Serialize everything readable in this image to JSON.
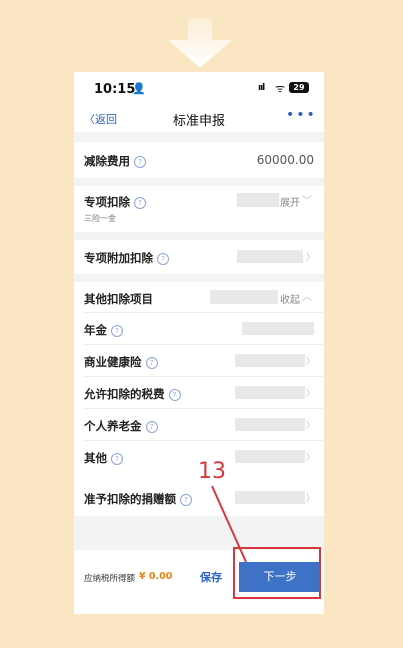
{
  "status_bar": {
    "time": "10:15",
    "person_glyph": "👤",
    "signal": "ııl",
    "wifi_glyph": "ᯤ",
    "battery": "29"
  },
  "nav": {
    "back_label": "〈返回",
    "title": "标准申报",
    "more": "•••"
  },
  "rows": {
    "deduction_fee": {
      "label": "减除费用",
      "value": "60000.00"
    },
    "special_deduction": {
      "label": "专项扣除",
      "sub": "三险一金",
      "action": "展开"
    },
    "special_additional": {
      "label": "专项附加扣除"
    },
    "other_deduction": {
      "label": "其他扣除项目",
      "action": "收起"
    },
    "annuity": {
      "label": "年金"
    },
    "health_insurance": {
      "label": "商业健康险"
    },
    "allowed_tax": {
      "label": "允许扣除的税费"
    },
    "pension": {
      "label": "个人养老金"
    },
    "other": {
      "label": "其他"
    },
    "donation": {
      "label": "准予扣除的捐赠额"
    }
  },
  "bottom": {
    "taxable_label": "应纳税所得额",
    "taxable_value": "¥ 0.00",
    "save_label": "保存",
    "next_label": "下一步"
  },
  "annotation": {
    "step_number": "13",
    "color": "#d9363e"
  },
  "colors": {
    "accent": "#3d72c6",
    "background": "#fbe6c3",
    "highlight": "#e8841a"
  },
  "icons": {
    "help": "question-circle-icon",
    "chevron": "chevron-right-icon"
  }
}
